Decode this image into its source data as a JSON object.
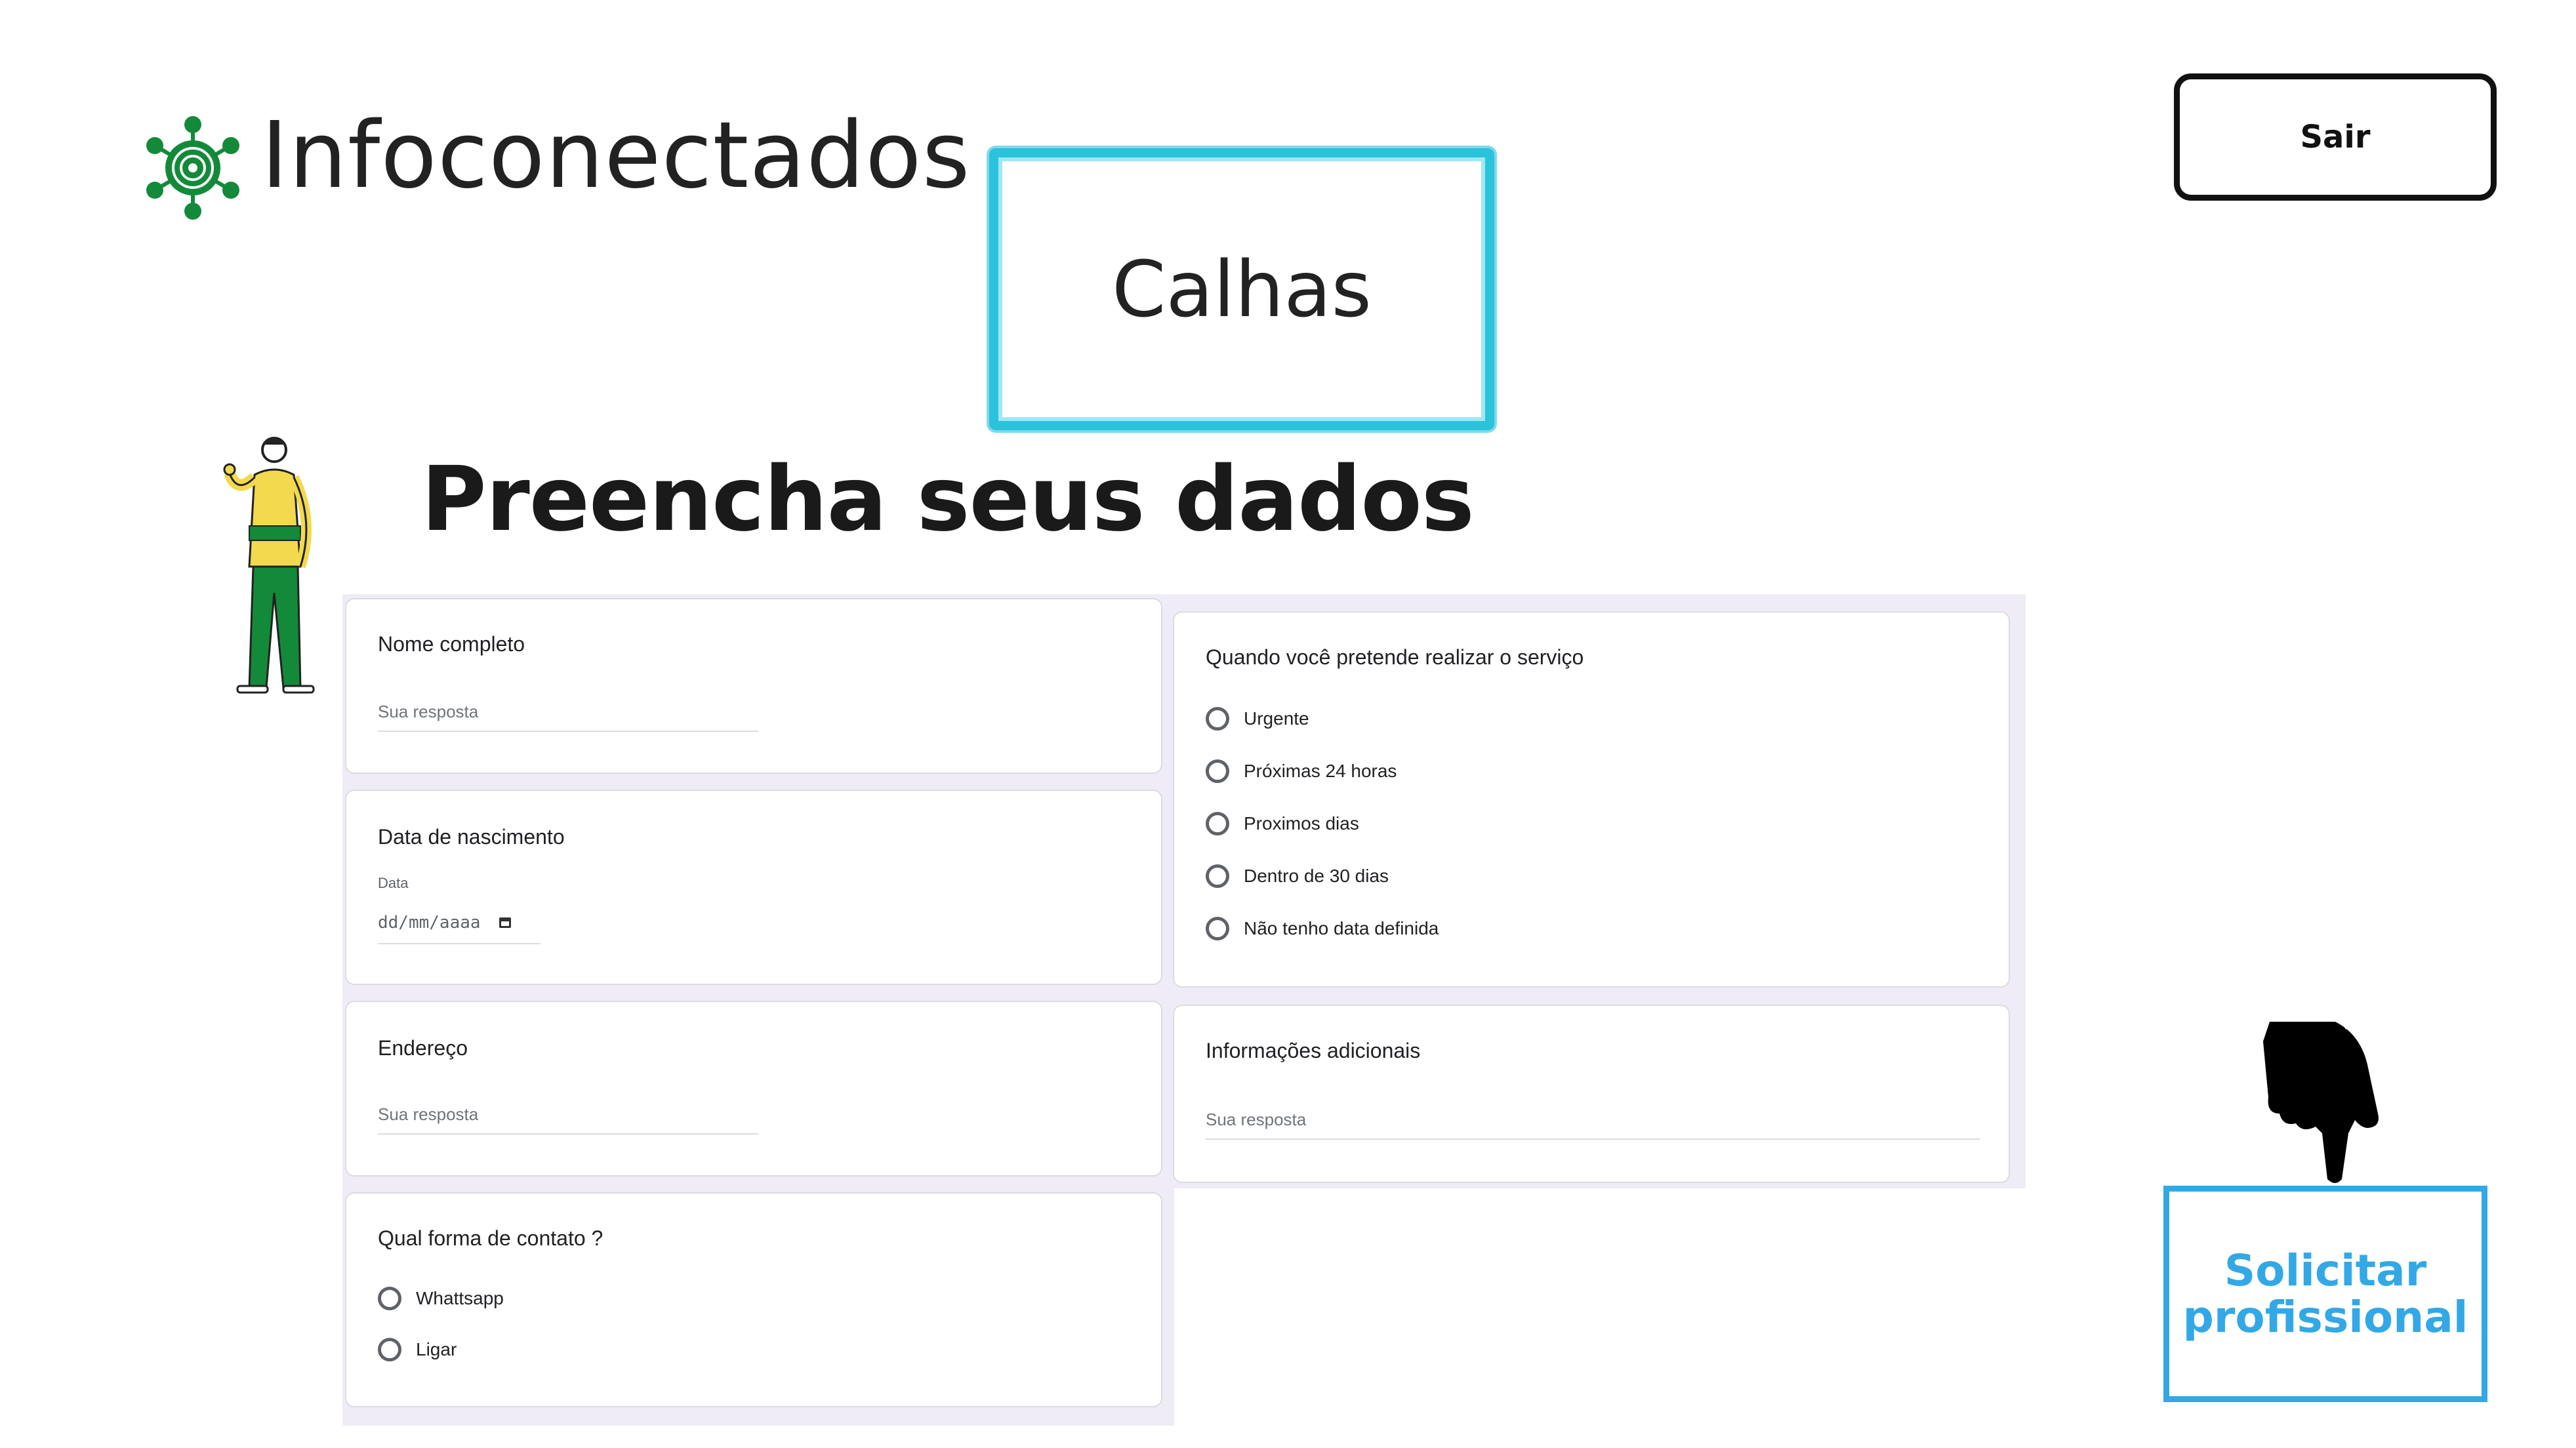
{
  "header": {
    "brand": "Infoconectados",
    "service": "Calhas",
    "logout_label": "Sair"
  },
  "page": {
    "heading": "Preencha seus dados"
  },
  "form": {
    "name": {
      "label": "Nome completo",
      "placeholder": "Sua resposta"
    },
    "birth": {
      "label": "Data de nascimento",
      "sublabel": "Data",
      "placeholder": "dd/mm/aaaa"
    },
    "address": {
      "label": "Endereço",
      "placeholder": "Sua resposta"
    },
    "contact": {
      "label": "Qual forma de contato ?",
      "options": [
        "Whattsapp",
        "Ligar"
      ]
    },
    "when": {
      "label": "Quando você pretende realizar o serviço",
      "options": [
        "Urgente",
        "Próximas 24 horas",
        "Proximos dias",
        "Dentro de 30 dias",
        "Não tenho data definida"
      ]
    },
    "info": {
      "label": "Informações adicionais",
      "placeholder": "Sua resposta"
    }
  },
  "cta": {
    "line1": "Solicitar",
    "line2": "profissional",
    "color": "#33a8e6"
  },
  "colors": {
    "brand_green": "#138a3a",
    "calhas_border": "#2bc2dc"
  },
  "icons": {
    "logo": "network-hub-icon",
    "hand": "pointing-down-hand-icon",
    "person": "person-illustration",
    "calendar": "calendar-icon"
  }
}
